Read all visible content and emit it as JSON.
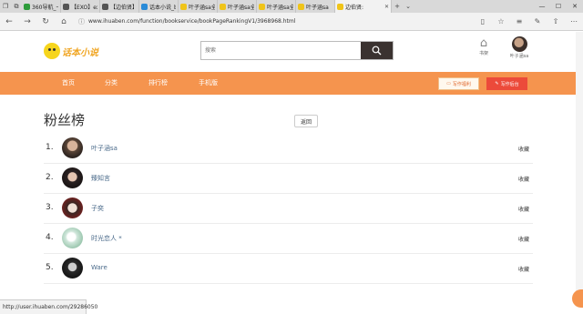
{
  "browser": {
    "tabs": [
      {
        "label": "360导航_一个",
        "color": "#2d9b3a"
      },
      {
        "label": "【EXO】exo",
        "color": "#555555"
      },
      {
        "label": "【边伯贤】L",
        "color": "#555555"
      },
      {
        "label": "话本小说_bb",
        "color": "#2a8bd8"
      },
      {
        "label": "叶子涵sa全部",
        "color": "#f0c419"
      },
      {
        "label": "叶子涵sa全部",
        "color": "#f0c419"
      },
      {
        "label": "叶子涵sa全部",
        "color": "#f0c419"
      },
      {
        "label": "叶子涵sa",
        "color": "#f0c419"
      },
      {
        "label": "边伯贤:",
        "color": "#f0c419"
      }
    ],
    "url": "www.ihuaben.com/function/bookservice/bookPageRankingV1/3968968.html",
    "status_url": "http://user.ihuaben.com/29286050"
  },
  "header": {
    "logo_text": "话本小说",
    "search_placeholder": "搜索",
    "shelf_label": "书架",
    "user_name": "叶子涵sa"
  },
  "nav": {
    "items": [
      "首页",
      "分类",
      "排行榜",
      "手机版"
    ],
    "welfare_label": "写作福利",
    "backend_label": "写作后台"
  },
  "page": {
    "title": "粉丝榜",
    "back_label": "返回",
    "fans": [
      {
        "rank": "1.",
        "name": "叶子涵sa",
        "action": "收藏"
      },
      {
        "rank": "2.",
        "name": "臻知言",
        "action": "收藏"
      },
      {
        "rank": "3.",
        "name": "子奕",
        "action": "收藏"
      },
      {
        "rank": "4.",
        "name": "时光恋人 *",
        "action": "收藏"
      },
      {
        "rank": "5.",
        "name": "Ware",
        "action": "收藏"
      }
    ]
  },
  "colors": {
    "brand_orange": "#f5944e",
    "search_button": "#3a3230",
    "backend_red": "#ec4a3a",
    "fan_name_blue": "#4a6a8a"
  }
}
